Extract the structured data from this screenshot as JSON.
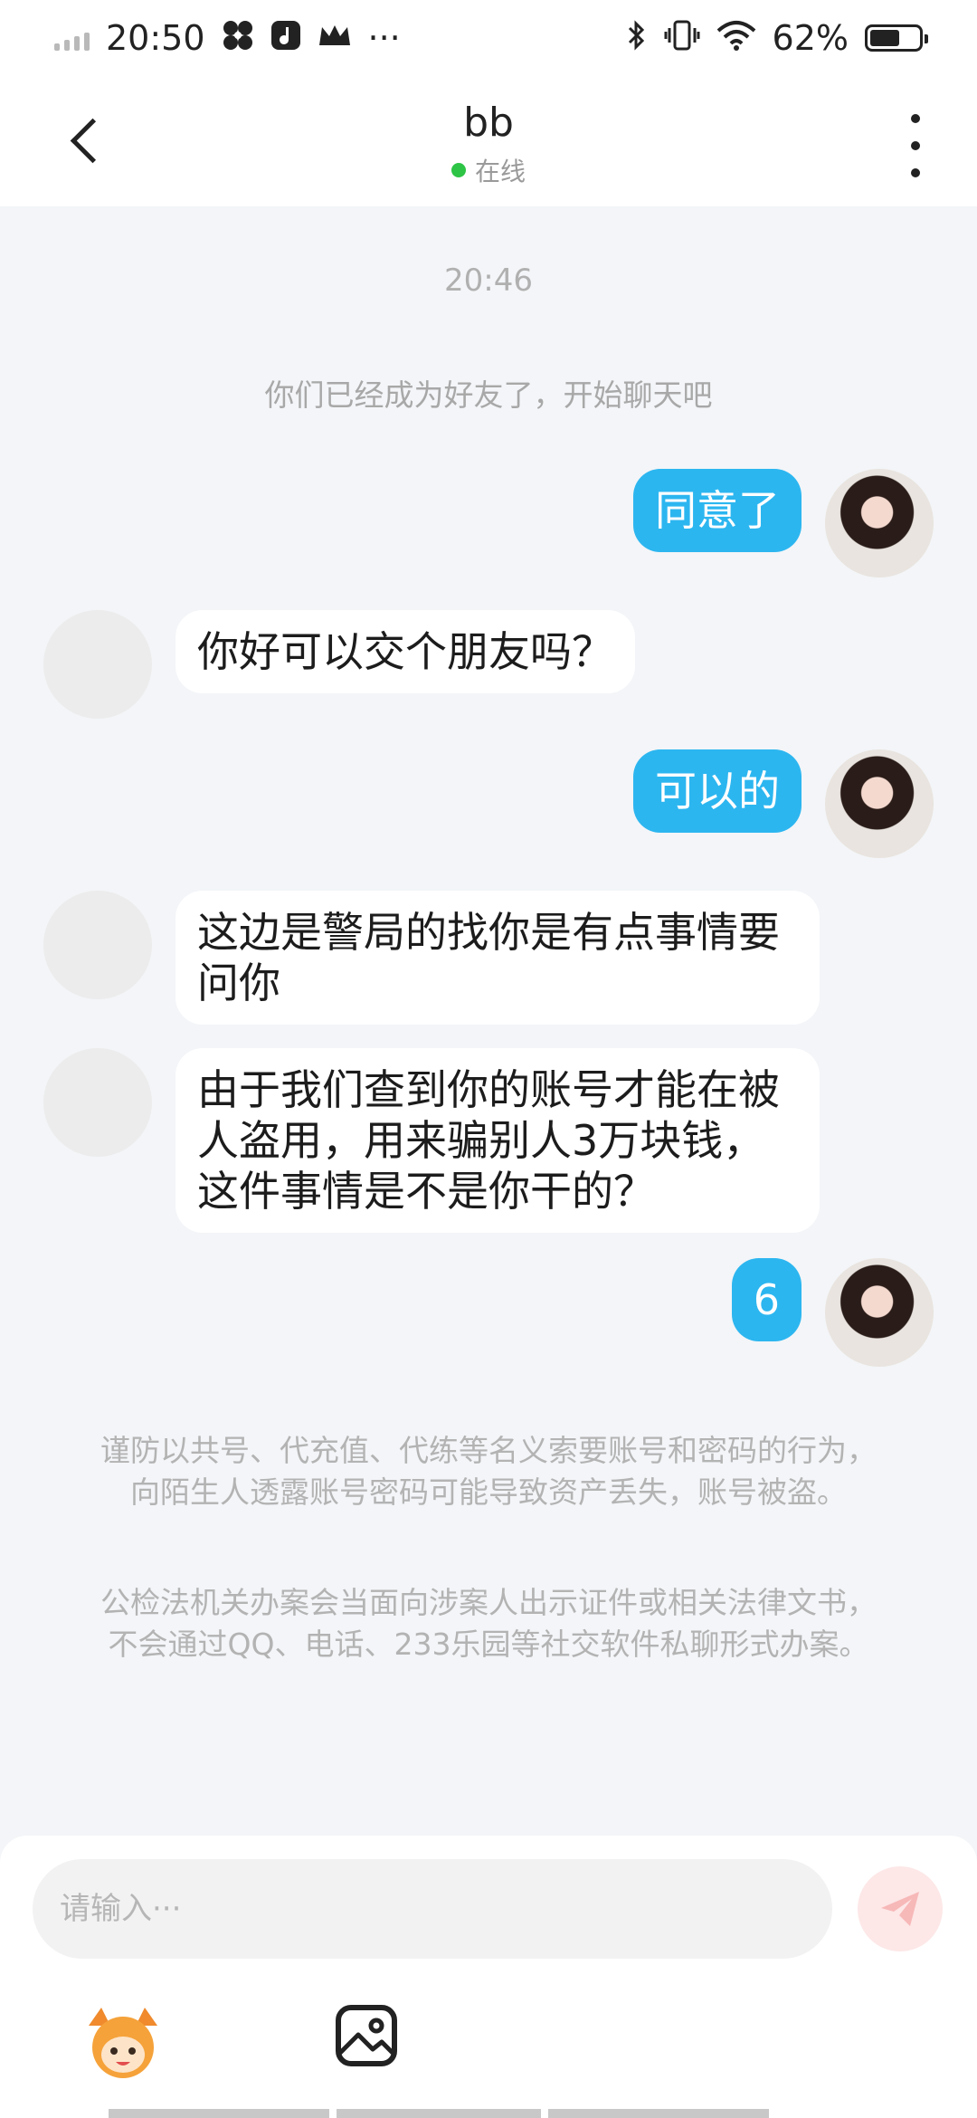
{
  "status_bar": {
    "time": "20:50",
    "app_icons": [
      "pinwheel-icon",
      "music-icon",
      "crown-icon"
    ],
    "overflow": "···",
    "battery_percent": "62%",
    "battery_level": 0.62
  },
  "header": {
    "contact_name": "bb",
    "online_status": "在线",
    "online_color": "#2ec445"
  },
  "chat": {
    "timestamp": "20:46",
    "system_note": "你们已经成为好友了，开始聊天吧",
    "messages": [
      {
        "from": "self",
        "text": "同意了"
      },
      {
        "from": "other",
        "text": "你好可以交个朋友吗？"
      },
      {
        "from": "self",
        "text": "可以的"
      },
      {
        "from": "other",
        "text": "这边是警局的找你是有点事情要问你"
      },
      {
        "from": "other",
        "text": "由于我们查到你的账号才能在被人盗用，用来骗别人3万块钱，这件事情是不是你干的？"
      },
      {
        "from": "self",
        "text": "6"
      }
    ],
    "warnings": [
      "谨防以共号、代充值、代练等名义索要账号和密码的行为，向陌生人透露账号密码可能导致资产丢失，账号被盗。",
      "公检法机关办案会当面向涉案人出示证件或相关法律文书，不会通过QQ、电话、233乐园等社交软件私聊形式办案。"
    ]
  },
  "composer": {
    "placeholder": "请输入···",
    "send_icon": "paper-plane-icon",
    "emoji_icon": "mascot-emoji-icon",
    "image_icon": "image-icon"
  },
  "colors": {
    "sent_bubble": "#2cb6f0",
    "received_bubble": "#ffffff",
    "background": "#f3f5f8"
  }
}
